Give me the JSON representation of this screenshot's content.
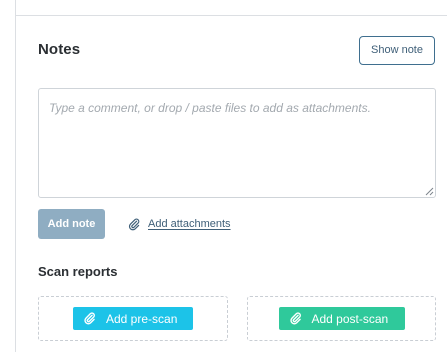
{
  "notes": {
    "title": "Notes",
    "show_note_label": "Show note",
    "comment_placeholder": "Type a comment, or drop / paste files to add as attachments.",
    "comment_value": "",
    "add_note_label": "Add note",
    "add_attachments_label": "Add attachments"
  },
  "scan_reports": {
    "title": "Scan reports",
    "pre_scan_label": "Add pre-scan",
    "post_scan_label": "Add post-scan"
  },
  "icons": {
    "attachment": "paperclip-icon"
  },
  "colors": {
    "link": "#3f5f78",
    "add_note_disabled": "#8fadc2",
    "pre_scan": "#1cc3e8",
    "post_scan": "#2fc99b"
  }
}
